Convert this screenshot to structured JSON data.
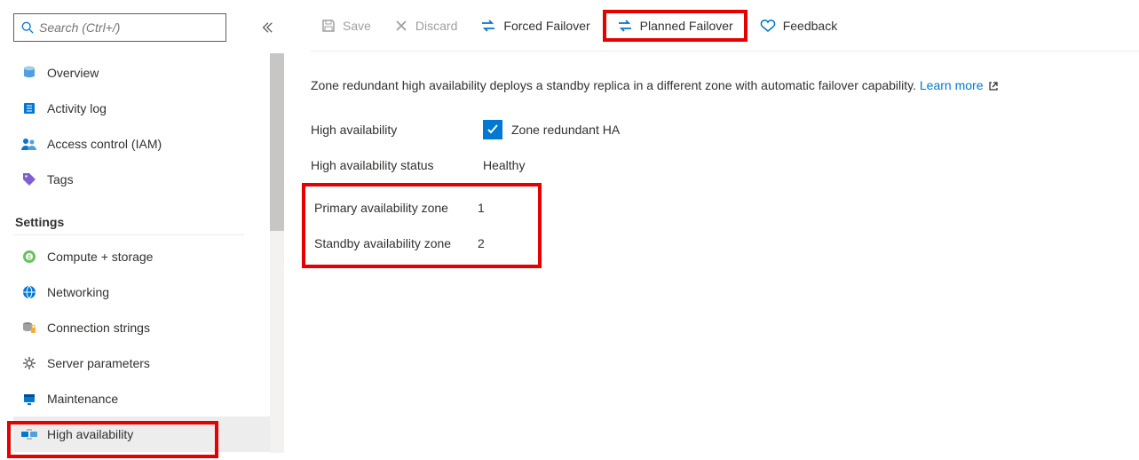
{
  "sidebar": {
    "search": {
      "placeholder": "Search (Ctrl+/)"
    },
    "items": [
      {
        "label": "Overview"
      },
      {
        "label": "Activity log"
      },
      {
        "label": "Access control (IAM)"
      },
      {
        "label": "Tags"
      }
    ],
    "settings_header": "Settings",
    "settings_items": [
      {
        "label": "Compute + storage"
      },
      {
        "label": "Networking"
      },
      {
        "label": "Connection strings"
      },
      {
        "label": "Server parameters"
      },
      {
        "label": "Maintenance"
      },
      {
        "label": "High availability"
      }
    ]
  },
  "toolbar": {
    "save": "Save",
    "discard": "Discard",
    "forced_failover": "Forced Failover",
    "planned_failover": "Planned Failover",
    "feedback": "Feedback"
  },
  "main": {
    "description": "Zone redundant high availability deploys a standby replica in a different zone with automatic failover capability.",
    "learn_more": "Learn more",
    "ha_label": "High availability",
    "ha_checkbox_label": "Zone redundant HA",
    "status_label": "High availability status",
    "status_value": "Healthy",
    "primary_label": "Primary availability zone",
    "primary_value": "1",
    "standby_label": "Standby availability zone",
    "standby_value": "2"
  }
}
